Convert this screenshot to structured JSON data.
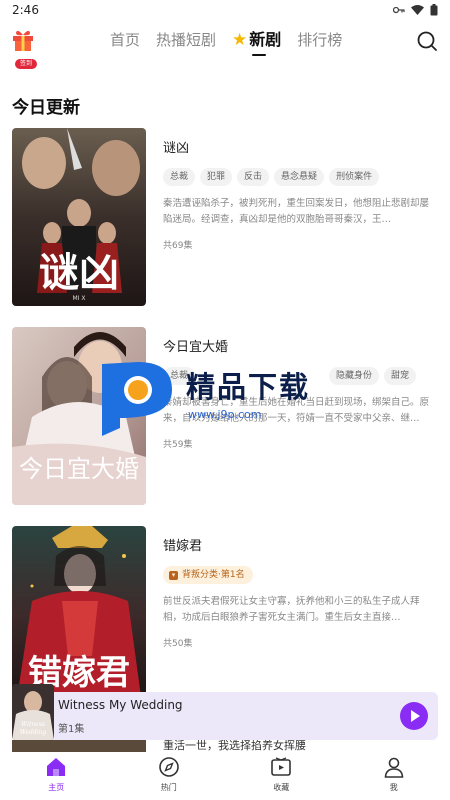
{
  "status_bar": {
    "time": "2:46"
  },
  "top_nav": {
    "gift_badge": "签到",
    "tabs": [
      {
        "label": "首页"
      },
      {
        "label": "热播短剧"
      },
      {
        "label": "新剧"
      },
      {
        "label": "排行榜"
      }
    ]
  },
  "section": {
    "title": "今日更新"
  },
  "dramas": [
    {
      "title": "谜凶",
      "tags": [
        "总裁",
        "犯罪",
        "反击",
        "悬念悬疑",
        "刑侦案件"
      ],
      "description": "秦浩遭诬陷杀子，被判死刑，重生回案发日，他想阻止悲剧却屡陷迷局。经调查，真凶却是他的双胞胎哥哥秦汉，王…",
      "episodes": "共69集",
      "poster_text": "谜凶",
      "poster_sub": "MI X"
    },
    {
      "title": "今日宜大婚",
      "tags": [
        "总裁",
        "隐藏身份",
        "甜宠"
      ],
      "description": "秦婧却被害身亡，重生后她在婚礼当日赶到现场，绑架自己。原来，自以为嫁给他人的那一天，符婧一直不受家中父亲、继…",
      "episodes": "共59集",
      "poster_text": "今日宜大婚"
    },
    {
      "title": "错嫁君",
      "rank": "背叛分类·第1名",
      "description": "前世反派夫君假死让女主守寡，抚养他和小三的私生子成人拜相，功成后白眼狼养子害死女主满门。重生后女主直接…",
      "episodes": "共50集",
      "poster_text": "错嫁君"
    }
  ],
  "watermark": {
    "text": "精品下载",
    "url": "www.j9p.com"
  },
  "mini_player": {
    "title": "Witness My Wedding",
    "episode": "第1集",
    "cover_text": "Witness My Wedding"
  },
  "peek": {
    "description": "重活一世，我选择掐养女挥腰"
  },
  "bottom_nav": [
    {
      "label": "主页",
      "icon": "home-icon"
    },
    {
      "label": "热门",
      "icon": "compass-icon"
    },
    {
      "label": "收藏",
      "icon": "play-box-icon"
    },
    {
      "label": "我",
      "icon": "person-icon"
    }
  ],
  "colors": {
    "accent": "#8b2cf5",
    "badge": "#e0283a",
    "rank": "#b5651d"
  }
}
